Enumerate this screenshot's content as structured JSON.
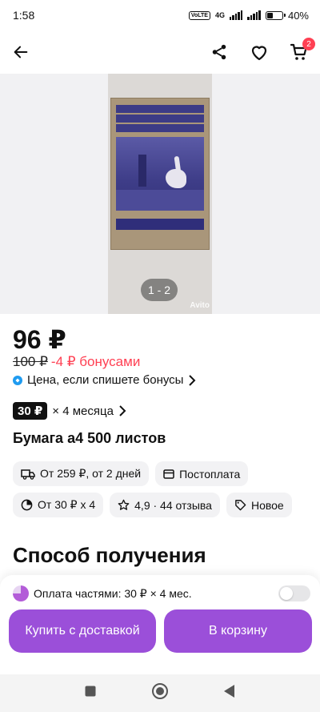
{
  "status_bar": {
    "time": "1:58",
    "network": "4G",
    "volte": "Vo LTE",
    "battery": "40%"
  },
  "top_bar": {
    "cart_count": "2",
    "icons": [
      "back-arrow-icon",
      "share-icon",
      "heart-icon",
      "cart-icon"
    ]
  },
  "gallery": {
    "counter": "1 - 2",
    "watermark": "Avito"
  },
  "price": {
    "main": "96 ₽",
    "old": "100 ₽",
    "bonus": "-4 ₽ бонусами",
    "bonus_note": "Цена, если спишете бонусы"
  },
  "installment": {
    "badge": "30 ₽",
    "text": "× 4 месяца"
  },
  "product": {
    "title": "Бумага а4 500 листов"
  },
  "chips": [
    {
      "icon": "truck-icon",
      "label": "От 259 ₽, от 2 дней"
    },
    {
      "icon": "card-icon",
      "label": "Постоплата"
    },
    {
      "icon": "installment-icon",
      "label": "От 30 ₽ х 4"
    },
    {
      "icon": "star-icon",
      "label": "4,9 · 44 отзыва"
    },
    {
      "icon": "tag-icon",
      "label": "Новое"
    }
  ],
  "section": {
    "title": "Способ получения"
  },
  "bottom": {
    "pay_label": "Оплата частями: 30 ₽ × 4 мес.",
    "pay_toggle_on": false,
    "buy_button": "Купить с доставкой",
    "cart_button": "В корзину",
    "accent_color": "#9b4fd9"
  }
}
